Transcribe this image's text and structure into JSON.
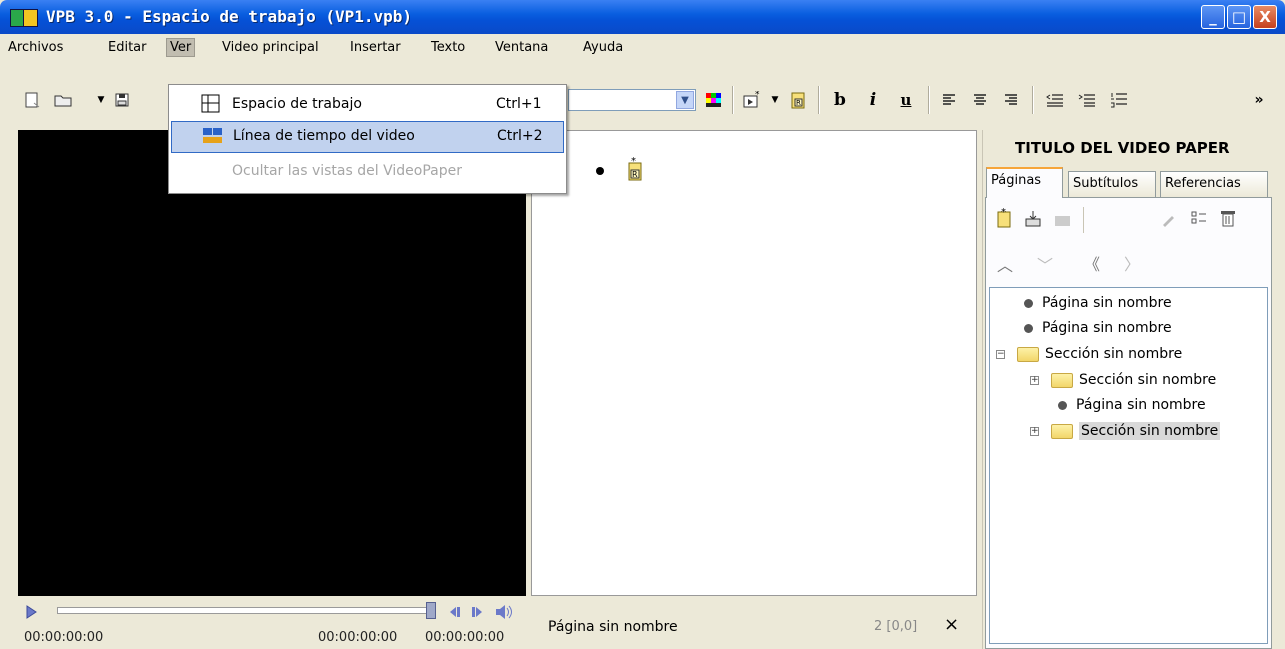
{
  "window": {
    "title": "VPB 3.0 - Espacio de trabajo (VP1.vpb)",
    "min": "_",
    "max": "□",
    "close": "X"
  },
  "menu": [
    "Archivos",
    "Editar",
    "Ver",
    "Video principal",
    "Insertar",
    "Texto",
    "Ventana",
    "Ayuda"
  ],
  "dropdown": {
    "items": [
      {
        "label": "Espacio de trabajo",
        "shortcut": "Ctrl+1",
        "icon": "workspace-icon"
      },
      {
        "label": "Línea de tiempo del video",
        "shortcut": "Ctrl+2",
        "icon": "timeline-icon"
      },
      {
        "label": "Ocultar las vistas del VideoPaper",
        "shortcut": "",
        "disabled": true
      }
    ]
  },
  "toolbar": {
    "bold": "b",
    "italic": "i",
    "underline": "u",
    "more": "»",
    "align_left": "≡",
    "align_center": "≡",
    "align_right": "≡",
    "dropdown_arrow": "⌄"
  },
  "player": {
    "time_left": "00:00:00:00",
    "time_mid": "00:00:00:00",
    "time_right": "00:00:00:00"
  },
  "editor": {
    "status_page": "Página sin nombre",
    "status_pos": "2 [0,0]",
    "close": "×"
  },
  "panel": {
    "title": "TITULO DEL VIDEO PAPER",
    "tabs": [
      "Páginas",
      "Subtítulos",
      "Referencias"
    ],
    "tree": [
      {
        "type": "page",
        "label": "Página sin nombre"
      },
      {
        "type": "page",
        "label": "Página sin nombre"
      },
      {
        "type": "section",
        "label": "Sección sin nombre",
        "expander": "−"
      },
      {
        "type": "section",
        "label": "Sección sin nombre",
        "expander": "+"
      },
      {
        "type": "page",
        "label": "Página sin nombre"
      },
      {
        "type": "section",
        "label": "Sección sin nombre",
        "expander": "+",
        "selected": true
      }
    ]
  }
}
